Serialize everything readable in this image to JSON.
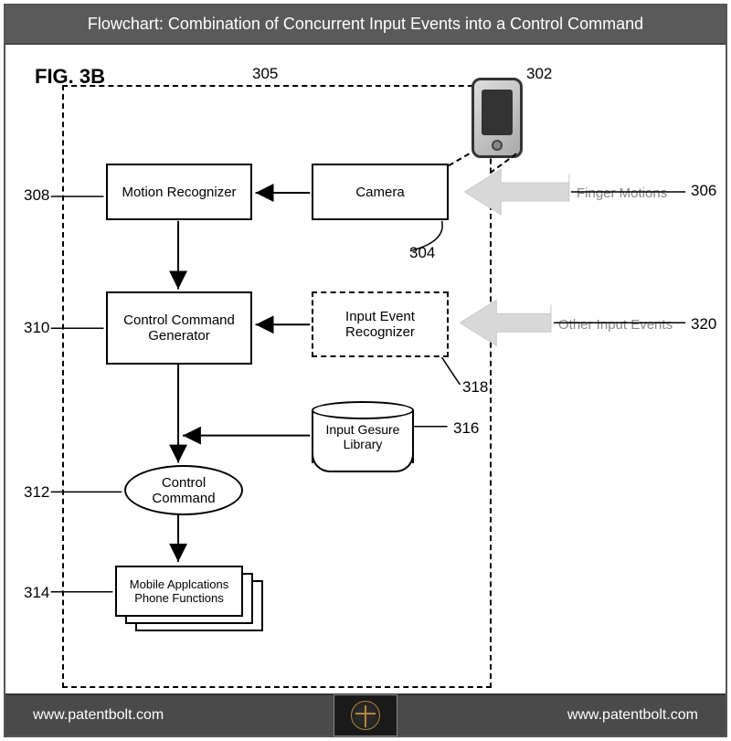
{
  "header": {
    "title": "Flowchart: Combination of Concurrent Input Events into a Control Command"
  },
  "figure": {
    "label": "FIG. 3B"
  },
  "refs": {
    "r302": "302",
    "r304": "304",
    "r305": "305",
    "r306": "306",
    "r308": "308",
    "r310": "310",
    "r312": "312",
    "r314": "314",
    "r316": "316",
    "r318": "318",
    "r320": "320"
  },
  "blocks": {
    "motion_recognizer": "Motion Recognizer",
    "camera": "Camera",
    "control_command_generator": "Control Command\nGenerator",
    "input_event_recognizer": "Input Event\nRecognizer",
    "input_gesture_library": "Input Gesure\nLibrary",
    "control_command": "Control\nCommand",
    "mobile_apps": "Mobile Applcations\nPhone Functions"
  },
  "inputs": {
    "finger_motions": "Finger Motions",
    "other_input_events": "Other Input Events"
  },
  "footer": {
    "left": "www.patentbolt.com",
    "right": "www.patentbolt.com"
  }
}
